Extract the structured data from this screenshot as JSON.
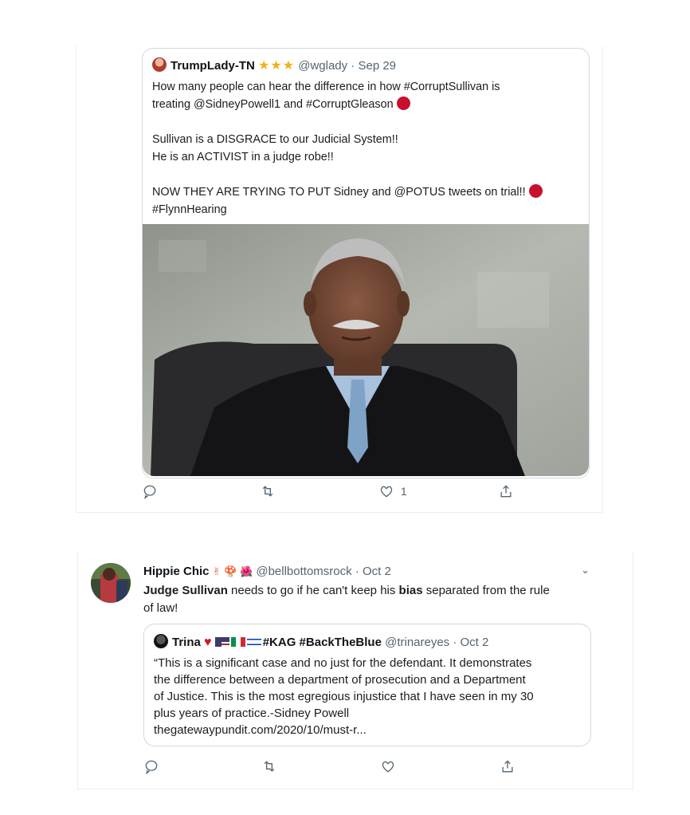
{
  "tweet1": {
    "name": "TrumpLady-TN",
    "stars": "★★★",
    "handle_date": "@wglady · Sep 29",
    "line1": "How many people can hear the difference in how #CorruptSullivan is",
    "line2": "treating @SidneyPowell1 and #CorruptGleason",
    "line3": "Sullivan is a DISGRACE to our Judicial System!!",
    "line4": "He is an ACTIVIST in a judge robe!!",
    "line5": "NOW THEY ARE TRYING TO PUT Sidney and @POTUS tweets on trial!!",
    "line6": "#FlynnHearing",
    "like_count": "1"
  },
  "tweet2": {
    "name": "Hippie Chic",
    "name_emojis": "✌ 🍄 🌺",
    "handle_date": "@bellbottomsrock · Oct 2",
    "body_bold1": "Judge Sullivan",
    "body_part2": " needs to go if he can't keep his ",
    "body_bold2": "bias",
    "body_part3": " separated from the rule",
    "body_line2": "of law!",
    "chevron": "⌄",
    "quoted": {
      "name": "Trina",
      "tags": "#KAG #BackTheBlue",
      "handle_date": "@trinareyes · Oct 2",
      "line1": "“This is a significant case and no just for the defendant. It demonstrates",
      "line2": "the difference between a department of prosecution and a Department",
      "line3": "of Justice. This is the most egregious injustice that I have seen in my 30",
      "line4": "plus years of practice.-Sidney Powell",
      "line5": "thegatewaypundit.com/2020/10/must-r..."
    }
  },
  "icons": [
    "reply-icon",
    "retweet-icon",
    "like-icon",
    "share-icon"
  ],
  "colors": {
    "star": "#f2b01e",
    "heart": "#c8102e",
    "icon": "#536471",
    "border": "#cfd9de"
  }
}
